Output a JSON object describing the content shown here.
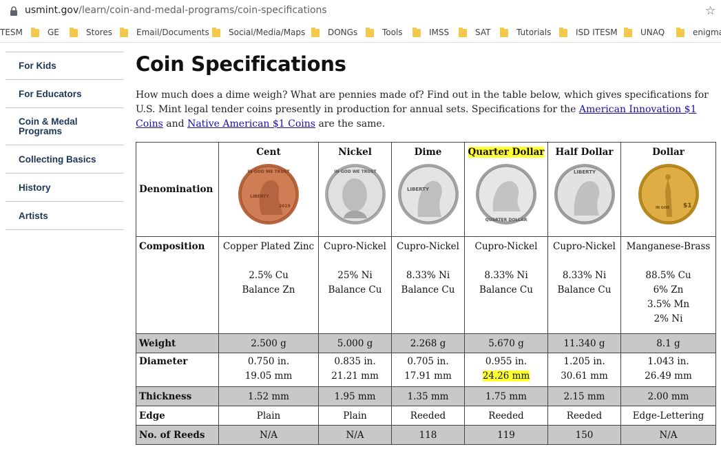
{
  "browser": {
    "url_host": "usmint.gov",
    "url_path": "/learn/coin-and-medal-programs/coin-specifications",
    "bookmarks": [
      "TESM",
      "GE",
      "Stores",
      "Email/Documents",
      "Social/Media/Maps",
      "DONGs",
      "Tools",
      "IMSS",
      "SAT",
      "Tutorials",
      "ISD ITESM",
      "UNAQ",
      "enigma"
    ]
  },
  "sidebar": {
    "items": [
      "For Kids",
      "For Educators",
      "Coin & Medal Programs",
      "Collecting Basics",
      "History",
      "Artists"
    ]
  },
  "page": {
    "title": "Coin Specifications",
    "intro_1": "How much does a dime weigh? What are pennies made of? Find out in the table below, which gives specifications for U.S. Mint legal tender coins presently in production for annual sets. Specifications for the ",
    "link_1": "American Innovation $1 Coins",
    "intro_2": " and ",
    "link_2": "Native American $1 Coins",
    "intro_3": " are the same."
  },
  "table": {
    "row_labels": {
      "denomination": "Denomination",
      "composition": "Composition",
      "weight": "Weight",
      "diameter": "Diameter",
      "thickness": "Thickness",
      "edge": "Edge",
      "reeds": "No. of Reeds"
    },
    "coins": [
      {
        "name": "Cent",
        "composition": [
          "Copper Plated Zinc",
          "",
          "2.5% Cu",
          "Balance Zn"
        ],
        "weight": "2.500 g",
        "diameter_in": "0.750 in.",
        "diameter_mm": "19.05 mm",
        "thickness": "1.52 mm",
        "edge": "Plain",
        "reeds": "N/A",
        "metal": "#c9754e",
        "coin_text": "LIBERTY 2019"
      },
      {
        "name": "Nickel",
        "composition": [
          "Cupro-Nickel",
          "",
          "25% Ni",
          "Balance Cu"
        ],
        "weight": "5.000 g",
        "diameter_in": "0.835 in.",
        "diameter_mm": "21.21 mm",
        "thickness": "1.95 mm",
        "edge": "Plain",
        "reeds": "N/A",
        "metal": "#c8c8c8",
        "coin_text": "IN GOD WE TRUST"
      },
      {
        "name": "Dime",
        "composition": [
          "Cupro-Nickel",
          "",
          "8.33% Ni",
          "Balance Cu"
        ],
        "weight": "2.268 g",
        "diameter_in": "0.705 in.",
        "diameter_mm": "17.91 mm",
        "thickness": "1.35 mm",
        "edge": "Reeded",
        "reeds": "118",
        "metal": "#cfcfcf",
        "coin_text": "LIBERTY"
      },
      {
        "name": "Quarter Dollar",
        "composition": [
          "Cupro-Nickel",
          "",
          "8.33% Ni",
          "Balance Cu"
        ],
        "weight": "5.670 g",
        "diameter_in": "0.955 in.",
        "diameter_mm": "24.26 mm",
        "thickness": "1.75 mm",
        "edge": "Reeded",
        "reeds": "119",
        "metal": "#d2d2d2",
        "coin_text": "QUARTER DOLLAR"
      },
      {
        "name": "Half Dollar",
        "composition": [
          "Cupro-Nickel",
          "",
          "8.33% Ni",
          "Balance Cu"
        ],
        "weight": "11.340 g",
        "diameter_in": "1.205 in.",
        "diameter_mm": "30.61 mm",
        "thickness": "2.15 mm",
        "edge": "Reeded",
        "reeds": "150",
        "metal": "#cdcdcd",
        "coin_text": "LIBERTY"
      },
      {
        "name": "Dollar",
        "composition": [
          "Manganese-Brass",
          "",
          "88.5% Cu",
          "6% Zn",
          "3.5% Mn",
          "2% Ni"
        ],
        "weight": "8.1 g",
        "diameter_in": "1.043 in.",
        "diameter_mm": "26.49 mm",
        "thickness": "2.00 mm",
        "edge": "Edge-Lettering",
        "reeds": "N/A",
        "metal": "#d4a437",
        "coin_text": "IN GOD WE TRUST $1"
      }
    ]
  },
  "colors": {
    "highlight": "#ffff33",
    "gray_row": "#c8c8c8",
    "sidebar_text": "#1d3557",
    "link": "#1a0dab"
  }
}
